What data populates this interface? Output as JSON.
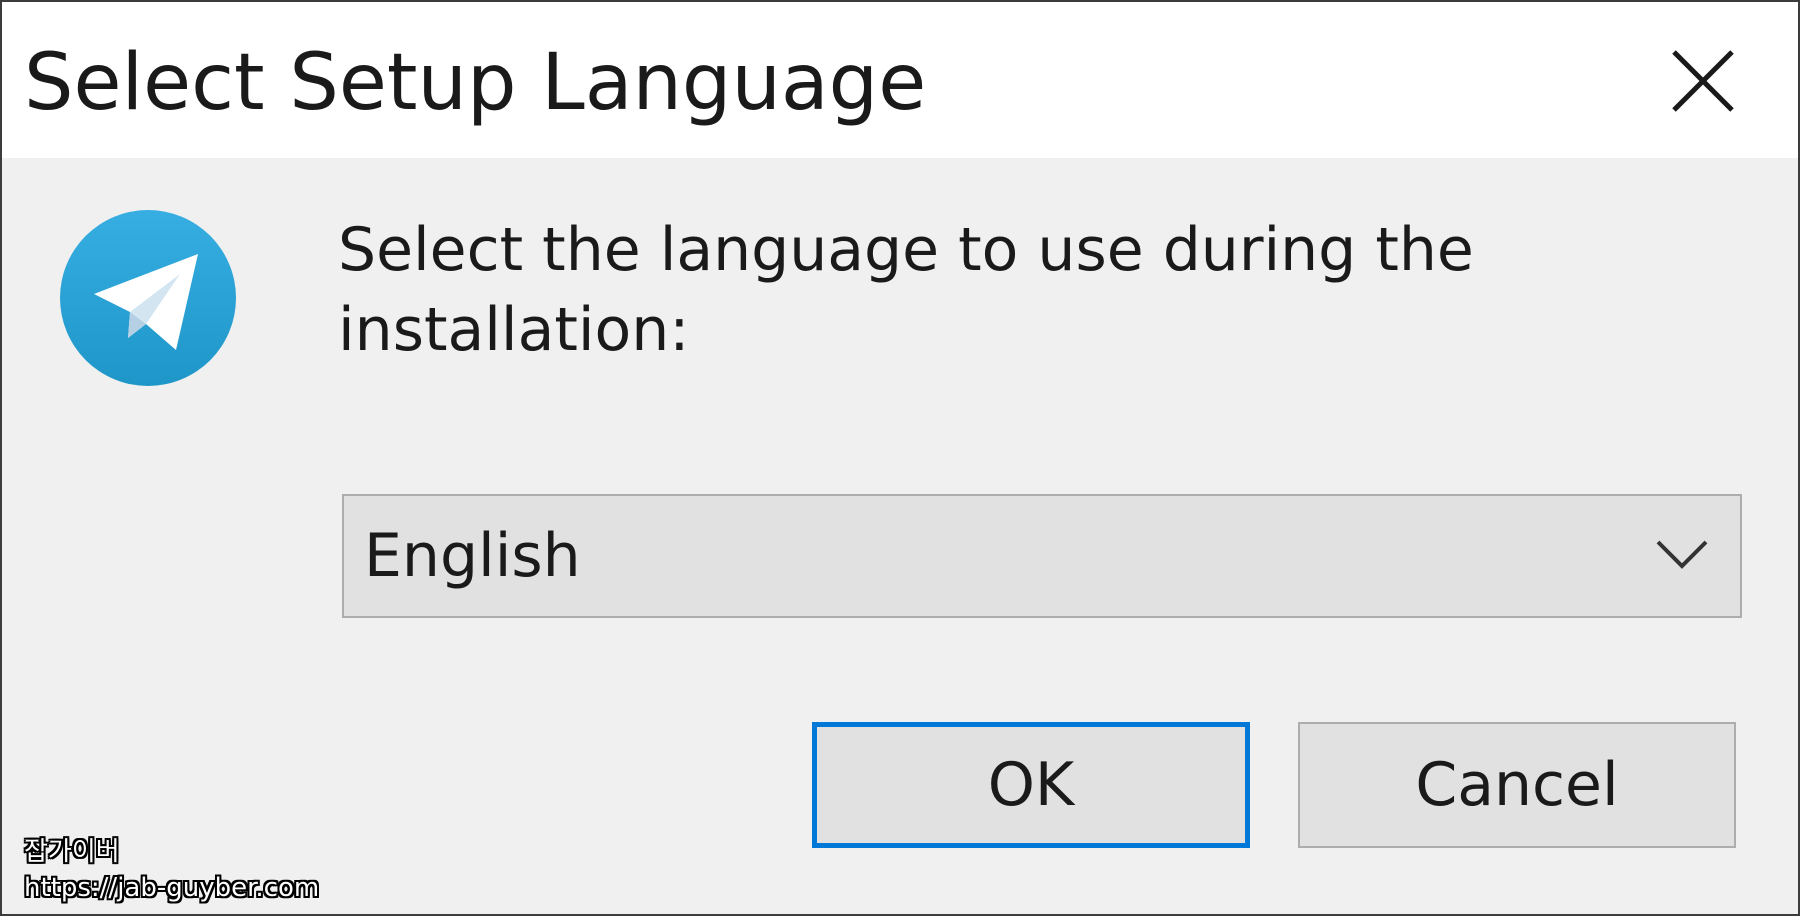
{
  "window": {
    "title": "Select Setup Language",
    "close_icon": "close-icon"
  },
  "content": {
    "app_icon": "telegram-icon",
    "prompt": "Select the language to use during the installation:",
    "language_select": {
      "selected": "English",
      "icon": "chevron-down-icon"
    }
  },
  "buttons": {
    "ok_label": "OK",
    "cancel_label": "Cancel"
  },
  "watermark": {
    "line1": "잡가이버",
    "line2": "https://jab-guyber.com"
  },
  "colors": {
    "accent": "#0078d7",
    "dialog_bg": "#f0f0f0",
    "titlebar_bg": "#ffffff",
    "telegram_blue": "#2ca5e0"
  }
}
